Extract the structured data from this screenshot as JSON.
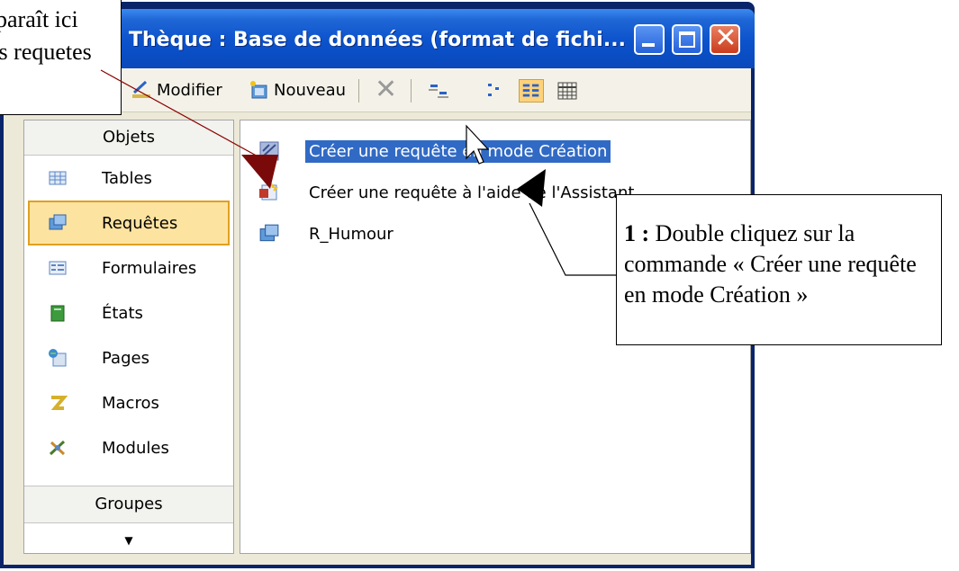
{
  "window": {
    "title": "Thèque : Base de données (format de fichi...",
    "minimize_icon": "minimize-icon",
    "maximize_icon": "maximize-icon",
    "close_icon": "close-icon"
  },
  "toolbar": {
    "modify_label": "Modifier",
    "new_label": "Nouveau"
  },
  "nav": {
    "header": "Objets",
    "items": [
      {
        "label": "Tables",
        "icon": "table-icon"
      },
      {
        "label": "Requêtes",
        "icon": "query-icon"
      },
      {
        "label": "Formulaires",
        "icon": "form-icon"
      },
      {
        "label": "États",
        "icon": "report-icon"
      },
      {
        "label": "Pages",
        "icon": "page-icon"
      },
      {
        "label": "Macros",
        "icon": "macro-icon"
      },
      {
        "label": "Modules",
        "icon": "module-icon"
      }
    ],
    "selected": "Requêtes",
    "groups": "Groupes"
  },
  "list": {
    "items": [
      {
        "label": "Créer une requête en mode Création",
        "icon": "design-view-icon",
        "selected": true
      },
      {
        "label": "Créer une requête à l'aide de l'Assistant",
        "icon": "wizard-icon",
        "selected": false
      },
      {
        "label": "R_Humour",
        "icon": "query-icon",
        "selected": false
      }
    ]
  },
  "callouts": {
    "top_left_line1": "paraît ici",
    "top_left_line2": "es requetes",
    "main_bold": "1 :",
    "main_text": " Double cliquez sur la commande « Créer une requête en mode Création »"
  },
  "colors": {
    "titlebar": "#0b52cc",
    "selection": "#316ac5",
    "nav_selected": "#fde3a0",
    "arrow_red": "#8b0000"
  }
}
